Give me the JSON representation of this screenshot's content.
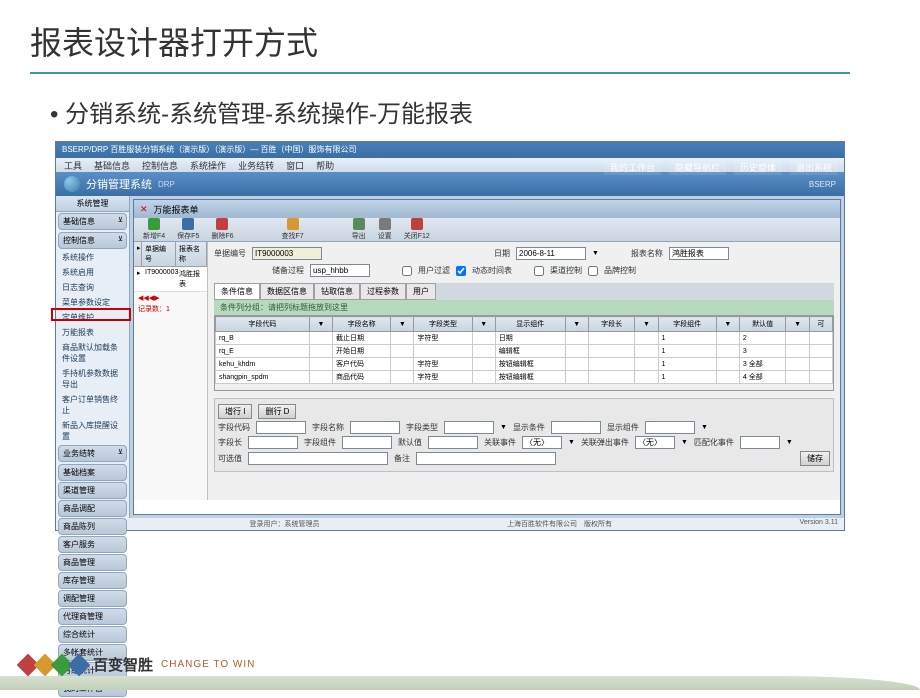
{
  "slide": {
    "title": "报表设计器打开方式",
    "breadcrumb": "分销系统-系统管理-系统操作-万能报表"
  },
  "app": {
    "titlebar": "BSERP/DRP 百胜服装分销系统（演示版）（演示版）— 百胜（中国）服饰有限公司",
    "brand_suffix": "BSERP",
    "menus": [
      "工具",
      "基础信息",
      "控制信息",
      "系统操作",
      "业务结转",
      "窗口",
      "帮助"
    ],
    "top_right": [
      "我的工作台",
      "隐藏导航栏",
      "历史窗体",
      "退出系统"
    ],
    "app_name": "分销管理系统",
    "app_name_sub": "DRP"
  },
  "sidebar": {
    "header": "系统管理",
    "groups": [
      {
        "label": "基础信息",
        "expanded": false
      },
      {
        "label": "控制信息",
        "expanded": true
      }
    ],
    "items": [
      "系统操作",
      "系统启用",
      "日志查询"
    ],
    "items2": [
      "菜单参数设定"
    ],
    "items3": [
      "定单维护",
      "万能报表"
    ],
    "items4": [
      "商品默认加载条件设置",
      "手持机参数数据导出",
      "客户订单销售终止"
    ],
    "items5": [
      "新品入库提醒设置"
    ],
    "groups_bottom": [
      {
        "label": "业务结转"
      }
    ],
    "sections": [
      "基础档案",
      "渠道管理",
      "商品调配",
      "商品陈列",
      "客户服务",
      "商品管理",
      "库存管理",
      "调配管理",
      "代理商管理",
      "综合统计",
      "多帐套统计",
      "月结统计",
      "我的工作台"
    ]
  },
  "tab": {
    "title": "万能报表单"
  },
  "toolbar": [
    {
      "label": "新增F4",
      "color": "#3a9b3a",
      "name": "add-button"
    },
    {
      "label": "保存F5",
      "color": "#3a6ea5",
      "name": "save-button"
    },
    {
      "label": "删除F6",
      "color": "#c04040",
      "name": "delete-button"
    },
    {
      "label": "查找F7",
      "color": "#d89830",
      "name": "find-button"
    },
    {
      "label": "导出",
      "color": "#5a8a5a",
      "name": "export-button"
    },
    {
      "label": "设置",
      "color": "#7a7a7a",
      "name": "settings-button"
    },
    {
      "label": "关闭F12",
      "color": "#c04040",
      "name": "close-button"
    }
  ],
  "list": {
    "columns": [
      "单据编号",
      "报表名称"
    ],
    "rows": [
      [
        "IT9000003",
        "鸿胜报表"
      ]
    ]
  },
  "form": {
    "doc_no_label": "单据编号",
    "doc_no": "IT9000003",
    "date_label": "日期",
    "date": "2006-8-11",
    "report_name_label": "报表名称",
    "report_name": "鸿胜报表",
    "sp_label": "储备过程",
    "sp": "usp_hhbb",
    "user_filter": "用户过滤",
    "dynamic_time": "动态时间表",
    "channel_ctrl": "渠道控制",
    "brand_ctrl": "品牌控制"
  },
  "tabs": [
    "条件信息",
    "数据区信息",
    "钻取信息",
    "过程参数",
    "用户"
  ],
  "info_text": "条件列分组：请把列标题拖放到这里",
  "grid": {
    "columns": [
      "字段代码",
      "字段名称",
      "字段类型",
      "显示组件",
      "字段长",
      "字段组件",
      "默认值",
      "可"
    ],
    "rows": [
      [
        "rq_B",
        "截止日期",
        "字符型",
        "日期",
        "",
        "1",
        "2",
        ""
      ],
      [
        "rq_E",
        "开始日期",
        "",
        "编辑框",
        "",
        "1",
        "3",
        ""
      ],
      [
        "kehu_khdm",
        "客户代码",
        "字符型",
        "按钮编辑框",
        "",
        "1",
        "3 全部",
        ""
      ],
      [
        "shangpin_spdm",
        "商品代码",
        "字符型",
        "按钮编辑框",
        "",
        "1",
        "4 全部",
        ""
      ]
    ]
  },
  "bottom_form": {
    "addrow": "增行 I",
    "delrow": "删行 D",
    "labels": [
      "字段代码",
      "字段名称",
      "字段类型",
      "显示条件",
      "显示组件"
    ],
    "labels2": [
      "字段长",
      "字段组件",
      "默认值",
      "关联事件",
      "关联弹出事件",
      "匹配化事件"
    ],
    "none_opt": "〈无〉",
    "options_label": "可选值",
    "remark_label": "备注",
    "save_btn": "储存"
  },
  "status": {
    "left": "记录数：1",
    "user": "登录用户：系统管理员",
    "company": "上海百胜软件有限公司　版权所有",
    "version": "Version 3.11"
  },
  "footer": {
    "logo": "百变智胜",
    "slogan": "CHANGE TO WIN"
  }
}
